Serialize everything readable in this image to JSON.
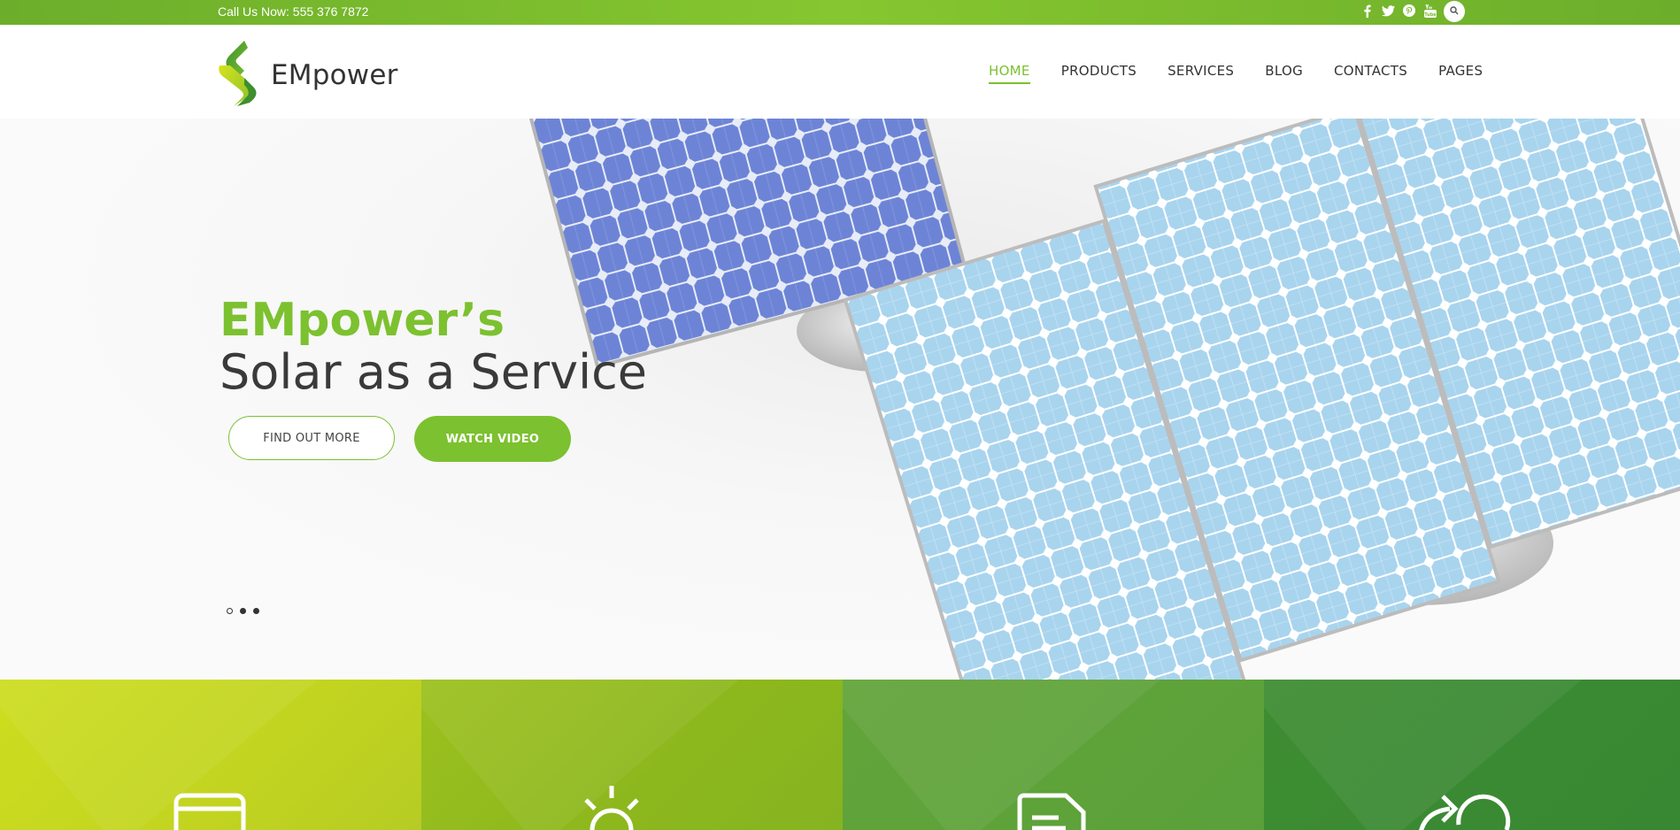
{
  "topbar": {
    "phone": "Call Us Now: 555 376 7872",
    "social": [
      "facebook-icon",
      "twitter-icon",
      "pinterest-icon",
      "youtube-icon"
    ],
    "search_icon": "search-icon"
  },
  "header": {
    "brand": "EMpower",
    "nav": [
      {
        "label": "HOME",
        "active": true
      },
      {
        "label": "PRODUCTS",
        "active": false
      },
      {
        "label": "SERVICES",
        "active": false
      },
      {
        "label": "BLOG",
        "active": false
      },
      {
        "label": "CONTACTS",
        "active": false
      },
      {
        "label": "PAGES",
        "active": false
      }
    ]
  },
  "hero": {
    "title_accent": "EMpower’s",
    "title_main": "Solar as a Service",
    "btn_find_out": "FIND OUT MORE",
    "btn_watch": "WATCH VIDEO",
    "slides": 3,
    "active_slide": 1
  },
  "features": {
    "icons": [
      "calculator-icon",
      "sun-icon",
      "document-icon",
      "cycle-arrow-icon"
    ]
  },
  "colors": {
    "accent": "#7cc12f",
    "text_dark": "#333333",
    "tile1": "#c8d920",
    "tile2": "#90b91d",
    "tile3": "#60a33a",
    "tile4": "#3b8b33"
  }
}
